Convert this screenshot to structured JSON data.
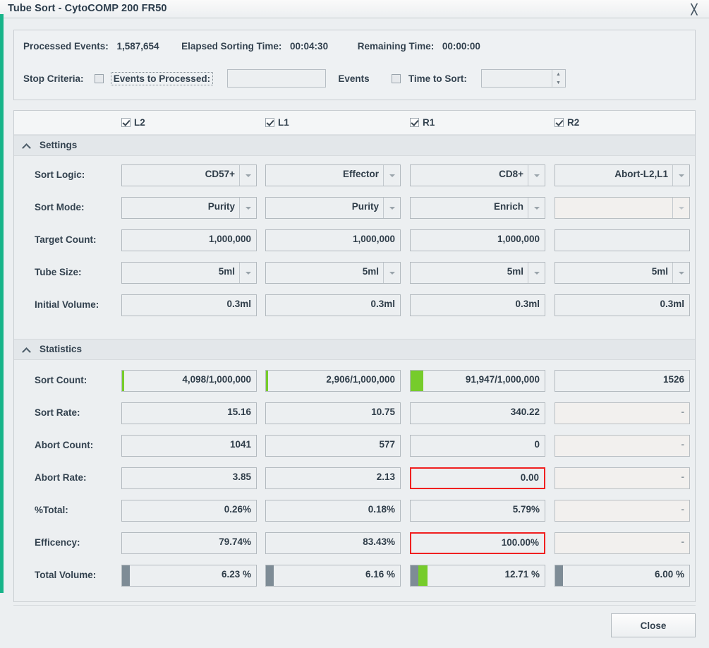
{
  "window": {
    "title": "Tube Sort - CytoCOMP 200 FR50",
    "close_icon": "close-icon",
    "accent_color": "#17b489"
  },
  "info": {
    "processed_events_label": "Processed Events:",
    "processed_events_value": "1,587,654",
    "elapsed_label": "Elapsed Sorting Time:",
    "elapsed_value": "00:04:30",
    "remaining_label": "Remaining Time:",
    "remaining_value": "00:00:00",
    "stop_criteria_label": "Stop Criteria:",
    "events_to_processed_label": "Events to Processed:",
    "events_to_processed_checked": false,
    "events_input_value": "",
    "events_unit_label": "Events",
    "time_to_sort_label": "Time to Sort:",
    "time_to_sort_checked": false,
    "time_input_value": ""
  },
  "columns": [
    {
      "label": "L2",
      "checked": true
    },
    {
      "label": "L1",
      "checked": true
    },
    {
      "label": "R1",
      "checked": true
    },
    {
      "label": "R2",
      "checked": true
    }
  ],
  "sections": {
    "settings": {
      "title": "Settings",
      "collapse_icon": "chevron-up-icon"
    },
    "statistics": {
      "title": "Statistics",
      "collapse_icon": "chevron-up-icon"
    }
  },
  "settings_rows": [
    {
      "label": "Sort Logic:",
      "type": "combo",
      "cells": [
        {
          "value": "CD57+",
          "combo": true,
          "disabled": false
        },
        {
          "value": "Effector",
          "combo": true,
          "disabled": false
        },
        {
          "value": "CD8+",
          "combo": true,
          "disabled": false
        },
        {
          "value": "Abort-L2,L1",
          "combo": true,
          "disabled": false
        }
      ]
    },
    {
      "label": "Sort Mode:",
      "type": "combo",
      "cells": [
        {
          "value": "Purity",
          "combo": true,
          "disabled": false
        },
        {
          "value": "Purity",
          "combo": true,
          "disabled": false
        },
        {
          "value": "Enrich",
          "combo": true,
          "disabled": false
        },
        {
          "value": "",
          "combo": true,
          "disabled": true
        }
      ]
    },
    {
      "label": "Target Count:",
      "type": "text",
      "cells": [
        {
          "value": "1,000,000",
          "combo": false,
          "disabled": false
        },
        {
          "value": "1,000,000",
          "combo": false,
          "disabled": false
        },
        {
          "value": "1,000,000",
          "combo": false,
          "disabled": false
        },
        {
          "value": "",
          "combo": false,
          "disabled": false
        }
      ]
    },
    {
      "label": "Tube Size:",
      "type": "combo",
      "cells": [
        {
          "value": "5ml",
          "combo": true,
          "disabled": false
        },
        {
          "value": "5ml",
          "combo": true,
          "disabled": false
        },
        {
          "value": "5ml",
          "combo": true,
          "disabled": false
        },
        {
          "value": "5ml",
          "combo": true,
          "disabled": false
        }
      ]
    },
    {
      "label": "Initial Volume:",
      "type": "text",
      "cells": [
        {
          "value": "0.3ml",
          "combo": false,
          "disabled": false
        },
        {
          "value": "0.3ml",
          "combo": false,
          "disabled": false
        },
        {
          "value": "0.3ml",
          "combo": false,
          "disabled": false
        },
        {
          "value": "0.3ml",
          "combo": false,
          "disabled": false
        }
      ]
    }
  ],
  "statistics_rows": [
    {
      "label": "Sort Count:",
      "cells": [
        {
          "value": "4,098/1,000,000",
          "disabled": false,
          "alert": false,
          "green_pct": 0.4,
          "gray_bar": false
        },
        {
          "value": "2,906/1,000,000",
          "disabled": false,
          "alert": false,
          "green_pct": 0.3,
          "gray_bar": false
        },
        {
          "value": "91,947/1,000,000",
          "disabled": false,
          "alert": false,
          "green_pct": 9.2,
          "gray_bar": false
        },
        {
          "value": "1526",
          "disabled": false,
          "alert": false,
          "green_pct": 0,
          "gray_bar": false
        }
      ]
    },
    {
      "label": "Sort Rate:",
      "cells": [
        {
          "value": "15.16",
          "disabled": false,
          "alert": false,
          "green_pct": 0,
          "gray_bar": false
        },
        {
          "value": "10.75",
          "disabled": false,
          "alert": false,
          "green_pct": 0,
          "gray_bar": false
        },
        {
          "value": "340.22",
          "disabled": false,
          "alert": false,
          "green_pct": 0,
          "gray_bar": false
        },
        {
          "value": "-",
          "disabled": true,
          "alert": false,
          "green_pct": 0,
          "gray_bar": false
        }
      ]
    },
    {
      "label": "Abort Count:",
      "cells": [
        {
          "value": "1041",
          "disabled": false,
          "alert": false,
          "green_pct": 0,
          "gray_bar": false
        },
        {
          "value": "577",
          "disabled": false,
          "alert": false,
          "green_pct": 0,
          "gray_bar": false
        },
        {
          "value": "0",
          "disabled": false,
          "alert": false,
          "green_pct": 0,
          "gray_bar": false
        },
        {
          "value": "-",
          "disabled": true,
          "alert": false,
          "green_pct": 0,
          "gray_bar": false
        }
      ]
    },
    {
      "label": "Abort Rate:",
      "cells": [
        {
          "value": "3.85",
          "disabled": false,
          "alert": false,
          "green_pct": 0,
          "gray_bar": false
        },
        {
          "value": "2.13",
          "disabled": false,
          "alert": false,
          "green_pct": 0,
          "gray_bar": false
        },
        {
          "value": "0.00",
          "disabled": false,
          "alert": true,
          "green_pct": 0,
          "gray_bar": false
        },
        {
          "value": "-",
          "disabled": true,
          "alert": false,
          "green_pct": 0,
          "gray_bar": false
        }
      ]
    },
    {
      "label": "%Total:",
      "cells": [
        {
          "value": "0.26%",
          "disabled": false,
          "alert": false,
          "green_pct": 0,
          "gray_bar": false
        },
        {
          "value": "0.18%",
          "disabled": false,
          "alert": false,
          "green_pct": 0,
          "gray_bar": false
        },
        {
          "value": "5.79%",
          "disabled": false,
          "alert": false,
          "green_pct": 0,
          "gray_bar": false
        },
        {
          "value": "-",
          "disabled": true,
          "alert": false,
          "green_pct": 0,
          "gray_bar": false
        }
      ]
    },
    {
      "label": "Efficency:",
      "cells": [
        {
          "value": "79.74%",
          "disabled": false,
          "alert": false,
          "green_pct": 0,
          "gray_bar": false
        },
        {
          "value": "83.43%",
          "disabled": false,
          "alert": false,
          "green_pct": 0,
          "gray_bar": false
        },
        {
          "value": "100.00%",
          "disabled": false,
          "alert": true,
          "green_pct": 0,
          "gray_bar": false
        },
        {
          "value": "-",
          "disabled": true,
          "alert": false,
          "green_pct": 0,
          "gray_bar": false
        }
      ]
    },
    {
      "label": "Total Volume:",
      "cells": [
        {
          "value": "6.23 %",
          "disabled": false,
          "alert": false,
          "green_pct": 0,
          "gray_bar": true
        },
        {
          "value": "6.16 %",
          "disabled": false,
          "alert": false,
          "green_pct": 0,
          "gray_bar": true
        },
        {
          "value": "12.71 %",
          "disabled": false,
          "alert": false,
          "green_pct": 6.8,
          "gray_bar": true
        },
        {
          "value": "6.00 %",
          "disabled": false,
          "alert": false,
          "green_pct": 0,
          "gray_bar": true
        }
      ]
    }
  ],
  "footer": {
    "close_label": "Close"
  }
}
